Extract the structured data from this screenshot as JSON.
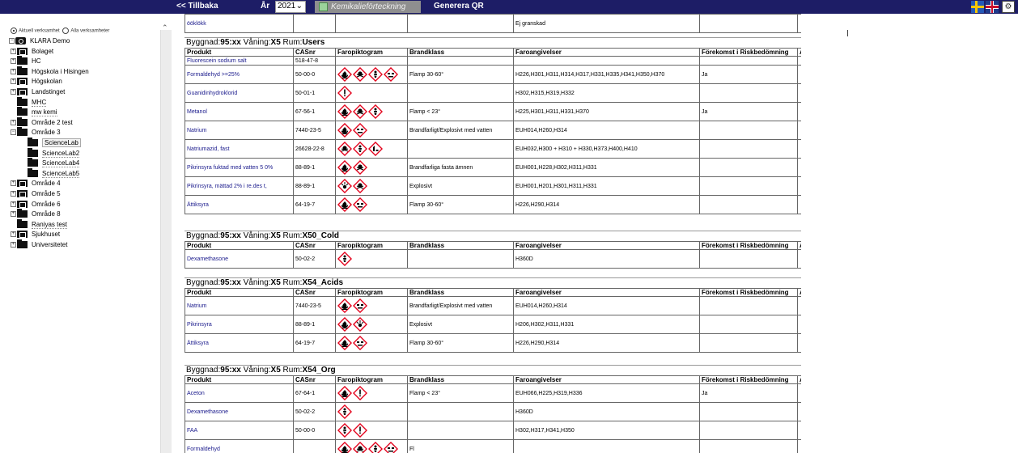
{
  "topbar": {
    "back": "<< Tillbaka",
    "year_label": "År",
    "year_value": "2021",
    "kemikalie_button": "Kemikalieförteckning",
    "qr_link": "Generera QR"
  },
  "left": {
    "radio_current": "Aktuell verksamhet",
    "radio_all": "Alla verksamheter",
    "tree": [
      {
        "label": "KLARA Demo",
        "kind": "root",
        "pm": "−",
        "indent": 0
      },
      {
        "label": "Bolaget",
        "kind": "bld",
        "pm": "+",
        "indent": 1
      },
      {
        "label": "HC",
        "kind": "folder",
        "pm": "+",
        "indent": 1
      },
      {
        "label": "Högskola i Hisingen",
        "kind": "folder",
        "pm": "+",
        "indent": 1
      },
      {
        "label": "Högskolan",
        "kind": "bld",
        "pm": "+",
        "indent": 1
      },
      {
        "label": "Landstinget",
        "kind": "bld",
        "pm": "+",
        "indent": 1
      },
      {
        "label": "MHC",
        "kind": "folder",
        "pm": "",
        "indent": 1
      },
      {
        "label": "mw kemi",
        "kind": "folder",
        "pm": "",
        "indent": 1
      },
      {
        "label": "Område 2 test",
        "kind": "folder",
        "pm": "+",
        "indent": 1
      },
      {
        "label": "Område 3",
        "kind": "folder",
        "pm": "−",
        "indent": 1
      },
      {
        "label": "ScienceLab",
        "kind": "folder",
        "pm": "",
        "indent": 2,
        "selected": true
      },
      {
        "label": "ScienceLab2",
        "kind": "folder",
        "pm": "",
        "indent": 2
      },
      {
        "label": "ScienceLab4",
        "kind": "folder",
        "pm": "",
        "indent": 2
      },
      {
        "label": "ScienceLab5",
        "kind": "folder",
        "pm": "",
        "indent": 2
      },
      {
        "label": "Område 4",
        "kind": "bld",
        "pm": "+",
        "indent": 1
      },
      {
        "label": "Område 5",
        "kind": "bld",
        "pm": "+",
        "indent": 1
      },
      {
        "label": "Område 6",
        "kind": "bld",
        "pm": "+",
        "indent": 1
      },
      {
        "label": "Område 8",
        "kind": "folder",
        "pm": "+",
        "indent": 1
      },
      {
        "label": "Raniyas test",
        "kind": "folder",
        "pm": "",
        "indent": 1
      },
      {
        "label": "Sjukhuset",
        "kind": "bld",
        "pm": "+",
        "indent": 1
      },
      {
        "label": "Universitetet",
        "kind": "folder",
        "pm": "+",
        "indent": 1
      }
    ]
  },
  "columns": [
    "Produkt",
    "CASnr",
    "Faropiktogram",
    "Brandklass",
    "Faroangivelser",
    "Förekomst i Riskbedömning",
    "A"
  ],
  "labels": {
    "byggnad": "Byggnad:",
    "vaning": "Våning:",
    "rum": "Rum:"
  },
  "top_row": {
    "product": "öökl­ökk",
    "cas": "",
    "brand": "",
    "faro": "Ej granskad",
    "risk": ""
  },
  "sections": [
    {
      "byggnad": "95:xx",
      "vaning": "X5",
      "rum": "Users",
      "rows": [
        {
          "product": "Fluorescein sodium salt",
          "cas": "518-47-8",
          "pictos": [],
          "brand": "",
          "faro": "",
          "risk": "",
          "short": true
        },
        {
          "product": "Formaldehyd >=25%",
          "cas": "50-00-0",
          "pictos": [
            "flame",
            "skull",
            "health",
            "corrosion"
          ],
          "brand": "Flamp 30-60°",
          "faro": "H226,H301,H311,H314,H317,H331,H335,H341,H350,H370",
          "risk": "Ja"
        },
        {
          "product": "Guanidinhydroklorid",
          "cas": "50-01-1",
          "pictos": [
            "exclamation"
          ],
          "brand": "",
          "faro": "H302,H315,H319,H332",
          "risk": ""
        },
        {
          "product": "Metanol",
          "cas": "67-56-1",
          "pictos": [
            "flame",
            "skull",
            "health"
          ],
          "brand": "Flamp < 23°",
          "faro": "H225,H301,H311,H331,H370",
          "risk": "Ja"
        },
        {
          "product": "Natrium",
          "cas": "7440-23-5",
          "pictos": [
            "flame",
            "corrosion"
          ],
          "brand": "Brandfarligt/Explosivt med vatten",
          "faro": "EUH014,H260,H314",
          "risk": ""
        },
        {
          "product": "Natriumazid, fast",
          "cas": "26628-22-8",
          "pictos": [
            "skull",
            "health",
            "environment"
          ],
          "brand": "",
          "faro": "EUH032,H300 + H310 + H330,H373,H400,H410",
          "risk": ""
        },
        {
          "product": "Pikrinsyra fuktad med vatten 5 0%",
          "cas": "88-89-1",
          "pictos": [
            "flame",
            "skull"
          ],
          "brand": "Brandfarliga fasta ämnen",
          "faro": "EUH001,H228,H302,H311,H331",
          "risk": ""
        },
        {
          "product": "Pikrinsyra, mättad 2% i re.des t,",
          "cas": "88-89-1",
          "pictos": [
            "explosive",
            "skull"
          ],
          "brand": "Explosivt",
          "faro": "EUH001,H201,H301,H311,H331",
          "risk": ""
        },
        {
          "product": "Ättiksyra",
          "cas": "64-19-7",
          "pictos": [
            "flame",
            "corrosion"
          ],
          "brand": "Flamp 30-60°",
          "faro": "H226,H290,H314",
          "risk": ""
        }
      ]
    },
    {
      "byggnad": "95:xx",
      "vaning": "X5",
      "rum": "X50_Cold",
      "rows": [
        {
          "product": "Dexamethasone",
          "cas": "50-02-2",
          "pictos": [
            "health"
          ],
          "brand": "",
          "faro": "H360D",
          "risk": ""
        }
      ]
    },
    {
      "byggnad": "95:xx",
      "vaning": "X5",
      "rum": "X54_Acids",
      "rows": [
        {
          "product": "Natrium",
          "cas": "7440-23-5",
          "pictos": [
            "flame",
            "corrosion"
          ],
          "brand": "Brandfarligt/Explosivt med vatten",
          "faro": "EUH014,H260,H314",
          "risk": ""
        },
        {
          "product": "Pikrinsyra",
          "cas": "88-89-1",
          "pictos": [
            "flame",
            "explosive"
          ],
          "brand": "Explosivt",
          "faro": "H206,H302,H311,H331",
          "risk": ""
        },
        {
          "product": "Ättiksyra",
          "cas": "64-19-7",
          "pictos": [
            "flame",
            "corrosion"
          ],
          "brand": "Flamp 30-60°",
          "faro": "H226,H290,H314",
          "risk": ""
        }
      ]
    },
    {
      "byggnad": "95:xx",
      "vaning": "X5",
      "rum": "X54_Org",
      "rows": [
        {
          "product": "Aceton",
          "cas": "67-64-1",
          "pictos": [
            "flame",
            "exclamation"
          ],
          "brand": "Flamp < 23°",
          "faro": "EUH066,H225,H319,H336",
          "risk": "Ja"
        },
        {
          "product": "Dexamethasone",
          "cas": "50-02-2",
          "pictos": [
            "health"
          ],
          "brand": "",
          "faro": "H360D",
          "risk": ""
        },
        {
          "product": "FAA",
          "cas": "50-00-0",
          "pictos": [
            "health",
            "exclamation"
          ],
          "brand": "",
          "faro": "H302,H317,H341,H350",
          "risk": ""
        },
        {
          "product": "Formaldehyd",
          "cas": "",
          "pictos": [
            "flame",
            "skull",
            "health",
            "corrosion"
          ],
          "brand": "Fl",
          "faro": "",
          "risk": ""
        }
      ]
    }
  ],
  "colors": {
    "topbar": "#1d1d66",
    "link": "#1a1a8c",
    "ghs_red": "#e3001b"
  }
}
